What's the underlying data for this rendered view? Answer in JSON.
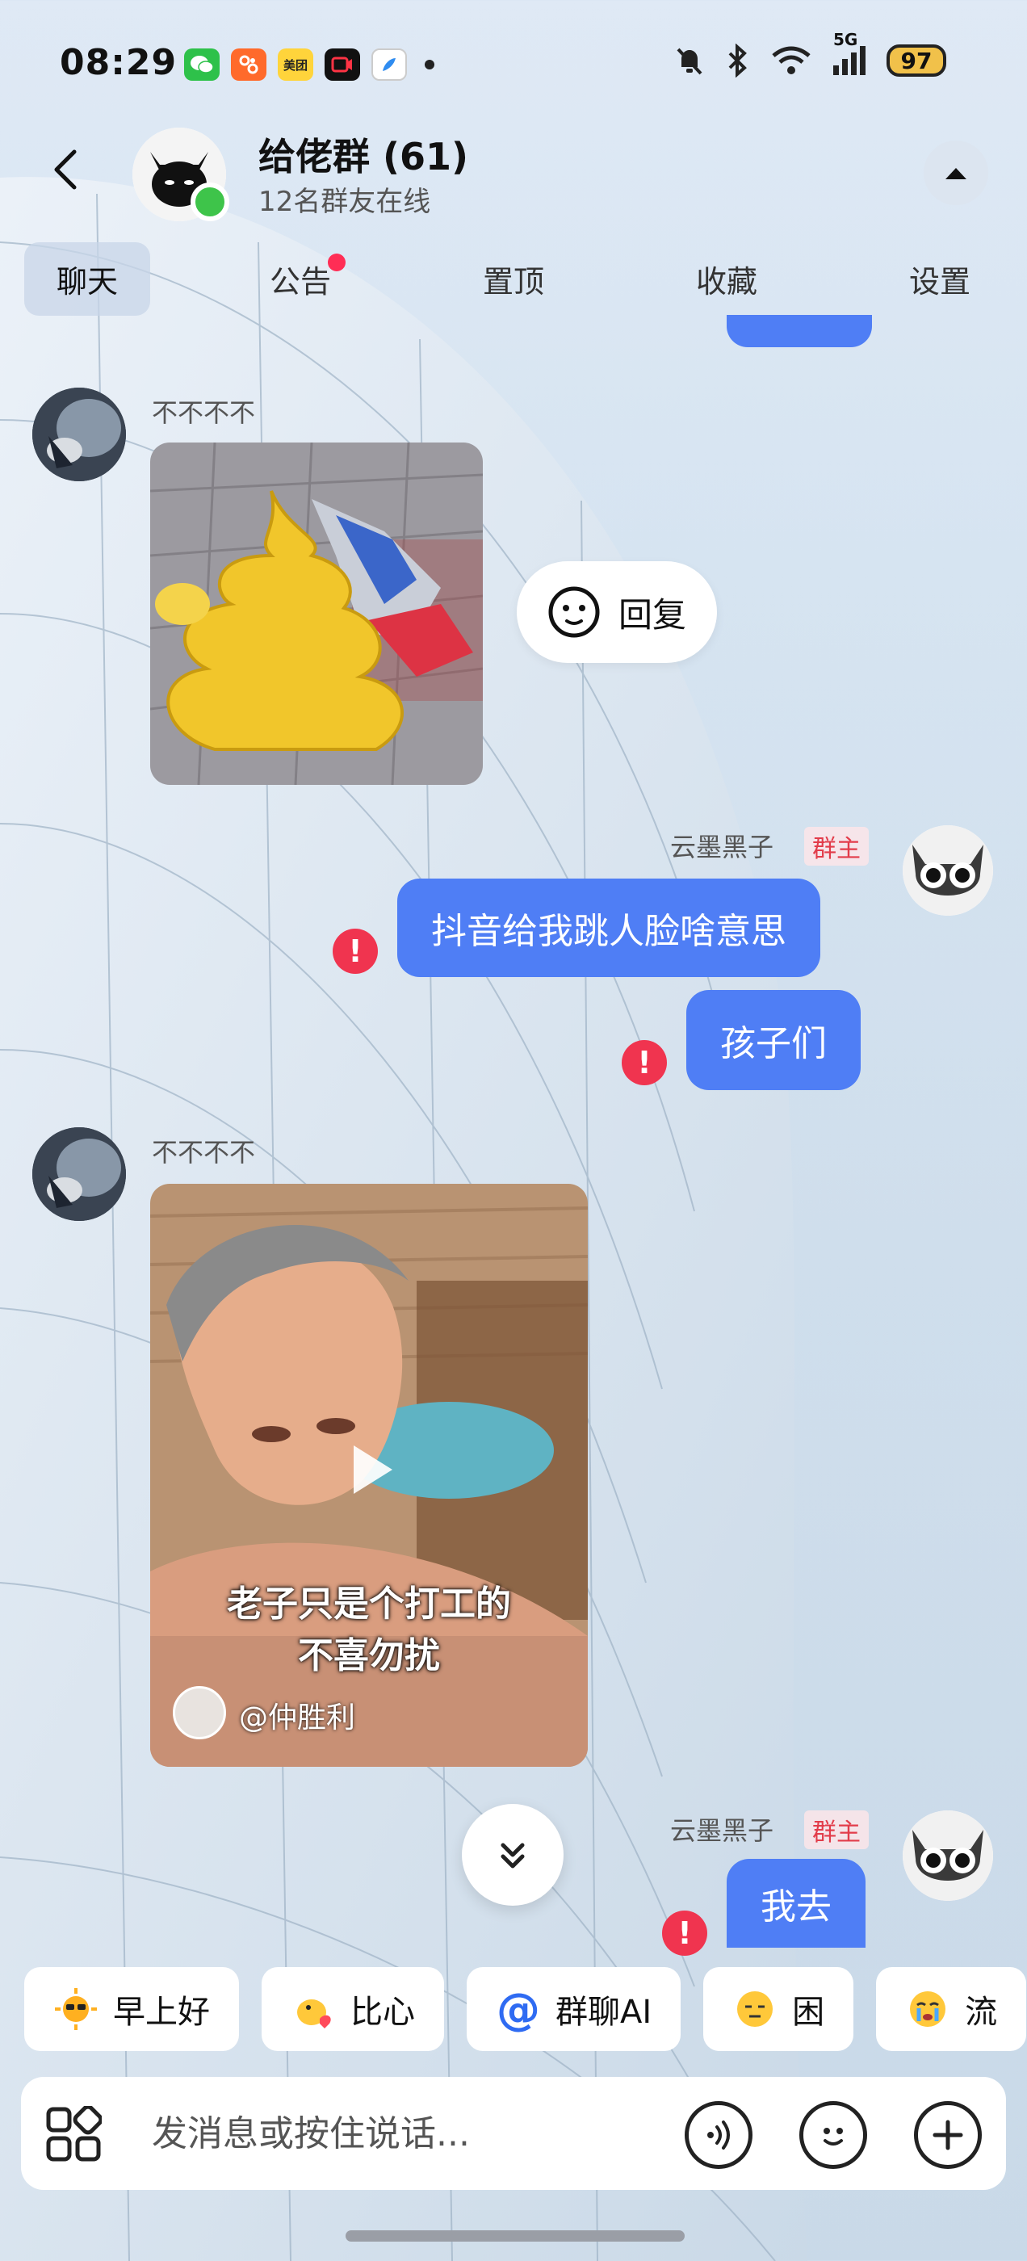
{
  "status_bar": {
    "time": "08:29",
    "app_icons": [
      "wechat-icon",
      "app-icon-orange",
      "meituan-icon",
      "video-app-icon",
      "bluefeather-icon"
    ],
    "meituan_label": "美团",
    "network": "5G",
    "battery": "97"
  },
  "header": {
    "title": "给佬群 (61)",
    "subtitle": "12名群友在线"
  },
  "tabs": [
    {
      "label": "聊天",
      "active": true
    },
    {
      "label": "公告",
      "badge": true
    },
    {
      "label": "置顶"
    },
    {
      "label": "收藏"
    },
    {
      "label": "设置"
    }
  ],
  "messages": [
    {
      "sender": "不不不不",
      "type": "image",
      "desc": "yellow poop toy with robot figure"
    },
    {
      "sender": "云墨黑子",
      "tag": "群主",
      "type": "text",
      "text": "抖音给我跳人脸啥意思",
      "failed": true
    },
    {
      "type": "text",
      "text": "孩子们",
      "failed": true
    },
    {
      "sender": "不不不不",
      "type": "video",
      "caption_line1": "老子只是个打工的",
      "caption_line2": "不喜勿扰",
      "author": "@仲胜利"
    },
    {
      "sender": "云墨黑子",
      "tag": "群主",
      "type": "text",
      "text": "我去",
      "failed": true
    }
  ],
  "reply_pill": {
    "label": "回复"
  },
  "quick_replies": [
    {
      "label": "早上好",
      "icon": "sun-sunglasses-icon"
    },
    {
      "label": "比心",
      "icon": "chick-heart-icon"
    },
    {
      "label": "群聊AI",
      "icon": "at-icon"
    },
    {
      "label": "困",
      "icon": "sleepy-face-icon"
    },
    {
      "label": "流",
      "icon": "crying-face-icon"
    }
  ],
  "input": {
    "placeholder": "发消息或按住说话..."
  },
  "colors": {
    "accent": "#4f7ef5",
    "error": "#f0344f",
    "owner_tag": "#e23c4a"
  }
}
